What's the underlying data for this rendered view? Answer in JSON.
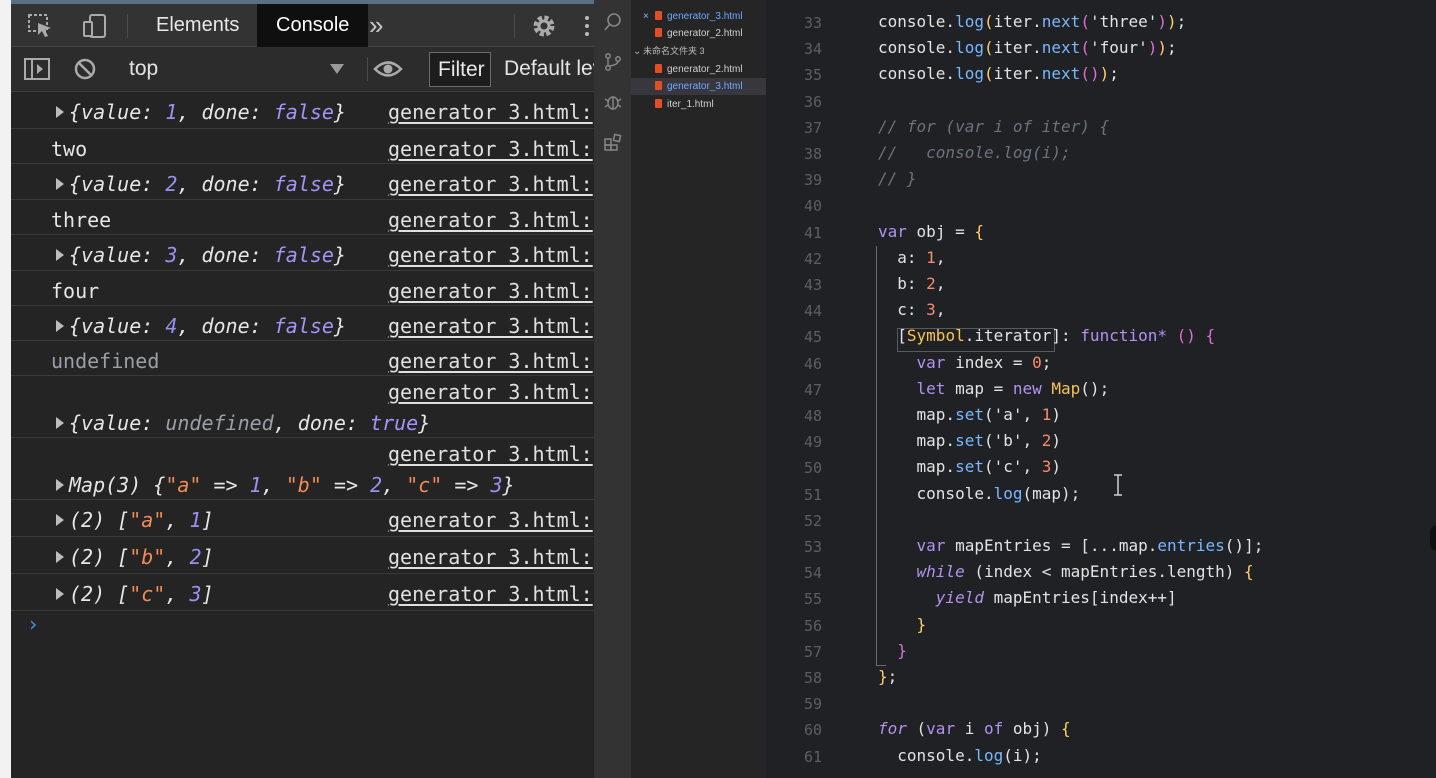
{
  "devtools": {
    "tabs": {
      "elements": "Elements",
      "console": "Console"
    },
    "toolbar": {
      "context": "top",
      "filter": "Filter",
      "levels": "Default lev"
    },
    "log": [
      {
        "msg": [
          [
            "obj",
            "{value: "
          ],
          [
            "num",
            "1"
          ],
          [
            "obj",
            ", done: "
          ],
          [
            "kw",
            "false"
          ],
          [
            "obj",
            "}"
          ]
        ],
        "expandable": true,
        "src": "generator_3.html:"
      },
      {
        "msg": [
          [
            "plain",
            "two"
          ]
        ],
        "expandable": false,
        "src": "generator_3.html:"
      },
      {
        "msg": [
          [
            "obj",
            "{value: "
          ],
          [
            "num",
            "2"
          ],
          [
            "obj",
            ", done: "
          ],
          [
            "kw",
            "false"
          ],
          [
            "obj",
            "}"
          ]
        ],
        "expandable": true,
        "src": "generator_3.html:"
      },
      {
        "msg": [
          [
            "plain",
            "three"
          ]
        ],
        "expandable": false,
        "src": "generator_3.html:"
      },
      {
        "msg": [
          [
            "obj",
            "{value: "
          ],
          [
            "num",
            "3"
          ],
          [
            "obj",
            ", done: "
          ],
          [
            "kw",
            "false"
          ],
          [
            "obj",
            "}"
          ]
        ],
        "expandable": true,
        "src": "generator_3.html:"
      },
      {
        "msg": [
          [
            "plain",
            "four"
          ]
        ],
        "expandable": false,
        "src": "generator_3.html:"
      },
      {
        "msg": [
          [
            "obj",
            "{value: "
          ],
          [
            "num",
            "4"
          ],
          [
            "obj",
            ", done: "
          ],
          [
            "kw",
            "false"
          ],
          [
            "obj",
            "}"
          ]
        ],
        "expandable": true,
        "src": "generator_3.html:"
      },
      {
        "msg": [
          [
            "und",
            "undefined"
          ]
        ],
        "expandable": false,
        "src": "generator_3.html:"
      },
      {
        "msg": [
          [
            "obj",
            "{value: "
          ],
          [
            "und",
            "undefined"
          ],
          [
            "obj",
            ", done: "
          ],
          [
            "kw",
            "true"
          ],
          [
            "obj",
            "}"
          ]
        ],
        "expandable": true,
        "src": "generator_3.html:",
        "wrap": true
      },
      {
        "msg": [
          [
            "obj",
            "Map(3) {"
          ],
          [
            "str",
            "\"a\""
          ],
          [
            "obj",
            " => "
          ],
          [
            "num",
            "1"
          ],
          [
            "obj",
            ", "
          ],
          [
            "str",
            "\"b\""
          ],
          [
            "obj",
            " => "
          ],
          [
            "num",
            "2"
          ],
          [
            "obj",
            ", "
          ],
          [
            "str",
            "\"c\""
          ],
          [
            "obj",
            " => "
          ],
          [
            "num",
            "3"
          ],
          [
            "obj",
            "}"
          ]
        ],
        "expandable": true,
        "src": "generator_3.html:",
        "wrap": true
      },
      {
        "msg": [
          [
            "obj",
            "(2) ["
          ],
          [
            "str",
            "\"a\""
          ],
          [
            "obj",
            ", "
          ],
          [
            "num",
            "1"
          ],
          [
            "obj",
            "]"
          ]
        ],
        "expandable": true,
        "src": "generator_3.html:"
      },
      {
        "msg": [
          [
            "obj",
            "(2) ["
          ],
          [
            "str",
            "\"b\""
          ],
          [
            "obj",
            ", "
          ],
          [
            "num",
            "2"
          ],
          [
            "obj",
            "]"
          ]
        ],
        "expandable": true,
        "src": "generator_3.html:"
      },
      {
        "msg": [
          [
            "obj",
            "(2) ["
          ],
          [
            "str",
            "\"c\""
          ],
          [
            "obj",
            ", "
          ],
          [
            "num",
            "3"
          ],
          [
            "obj",
            "]"
          ]
        ],
        "expandable": true,
        "src": "generator_3.html:"
      }
    ],
    "prompt_symbol": "›"
  },
  "vscode": {
    "explorer": {
      "open_editors": [
        {
          "name": "generator_3.html",
          "active": true,
          "closable": true
        },
        {
          "name": "generator_2.html",
          "active": false
        }
      ],
      "folder_label": "未命名文件夹 3",
      "files": [
        {
          "name": "generator_2.html",
          "active": false
        },
        {
          "name": "generator_3.html",
          "active": true
        },
        {
          "name": "iter_1.html",
          "active": false
        }
      ]
    },
    "code": [
      {
        "ln": "33",
        "tokens": [
          [
            "c-id",
            "console."
          ],
          [
            "c-fn",
            "log"
          ],
          [
            "c-br",
            "("
          ],
          [
            "c-id",
            "iter."
          ],
          [
            "c-fn",
            "next"
          ],
          [
            "c-br2",
            "("
          ],
          [
            "c-str",
            "'three'"
          ],
          [
            "c-br2",
            ")"
          ],
          [
            "c-br",
            ")"
          ],
          [
            "c-id",
            ";"
          ]
        ]
      },
      {
        "ln": "34",
        "tokens": [
          [
            "c-id",
            "console."
          ],
          [
            "c-fn",
            "log"
          ],
          [
            "c-br",
            "("
          ],
          [
            "c-id",
            "iter."
          ],
          [
            "c-fn",
            "next"
          ],
          [
            "c-br2",
            "("
          ],
          [
            "c-str",
            "'four'"
          ],
          [
            "c-br2",
            ")"
          ],
          [
            "c-br",
            ")"
          ],
          [
            "c-id",
            ";"
          ]
        ]
      },
      {
        "ln": "35",
        "tokens": [
          [
            "c-id",
            "console."
          ],
          [
            "c-fn",
            "log"
          ],
          [
            "c-br",
            "("
          ],
          [
            "c-id",
            "iter."
          ],
          [
            "c-fn",
            "next"
          ],
          [
            "c-br2",
            "()"
          ],
          [
            "c-br",
            ")"
          ],
          [
            "c-id",
            ";"
          ]
        ]
      },
      {
        "ln": "36",
        "tokens": []
      },
      {
        "ln": "37",
        "tokens": [
          [
            "c-cmt",
            "// for (var i of iter) {"
          ]
        ]
      },
      {
        "ln": "38",
        "tokens": [
          [
            "c-cmt",
            "//   console.log(i);"
          ]
        ]
      },
      {
        "ln": "39",
        "tokens": [
          [
            "c-cmt",
            "// }"
          ]
        ]
      },
      {
        "ln": "40",
        "tokens": []
      },
      {
        "ln": "41",
        "tokens": [
          [
            "c-kw",
            "var "
          ],
          [
            "c-id",
            "obj = "
          ],
          [
            "c-br",
            "{"
          ]
        ]
      },
      {
        "ln": "42",
        "tokens": [
          [
            "c-id",
            "  a: "
          ],
          [
            "c-num",
            "1"
          ],
          [
            "c-id",
            ","
          ]
        ]
      },
      {
        "ln": "43",
        "tokens": [
          [
            "c-id",
            "  b: "
          ],
          [
            "c-num",
            "2"
          ],
          [
            "c-id",
            ","
          ]
        ]
      },
      {
        "ln": "44",
        "tokens": [
          [
            "c-id",
            "  c: "
          ],
          [
            "c-num",
            "3"
          ],
          [
            "c-id",
            ","
          ]
        ]
      },
      {
        "ln": "45",
        "tokens": [
          [
            "c-id",
            "  ["
          ],
          [
            "c-sym",
            "Symbol"
          ],
          [
            "c-id",
            ".iterator]: "
          ],
          [
            "c-kw",
            "function* "
          ],
          [
            "c-br2",
            "() {"
          ]
        ]
      },
      {
        "ln": "46",
        "tokens": [
          [
            "c-kw",
            "    var "
          ],
          [
            "c-id",
            "index = "
          ],
          [
            "c-num",
            "0"
          ],
          [
            "c-id",
            ";"
          ]
        ]
      },
      {
        "ln": "47",
        "tokens": [
          [
            "c-kw",
            "    let "
          ],
          [
            "c-id",
            "map = "
          ],
          [
            "c-kw",
            "new "
          ],
          [
            "c-sym",
            "Map"
          ],
          [
            "c-id",
            "();"
          ]
        ]
      },
      {
        "ln": "48",
        "tokens": [
          [
            "c-id",
            "    map."
          ],
          [
            "c-fn",
            "set"
          ],
          [
            "c-id",
            "('a', "
          ],
          [
            "c-num",
            "1"
          ],
          [
            "c-id",
            ")"
          ]
        ]
      },
      {
        "ln": "49",
        "tokens": [
          [
            "c-id",
            "    map."
          ],
          [
            "c-fn",
            "set"
          ],
          [
            "c-id",
            "('b', "
          ],
          [
            "c-num",
            "2"
          ],
          [
            "c-id",
            ")"
          ]
        ]
      },
      {
        "ln": "50",
        "tokens": [
          [
            "c-id",
            "    map."
          ],
          [
            "c-fn",
            "set"
          ],
          [
            "c-id",
            "('c', "
          ],
          [
            "c-num",
            "3"
          ],
          [
            "c-id",
            ")"
          ]
        ]
      },
      {
        "ln": "51",
        "tokens": [
          [
            "c-id",
            "    console."
          ],
          [
            "c-fn",
            "log"
          ],
          [
            "c-id",
            "(map);"
          ]
        ]
      },
      {
        "ln": "52",
        "tokens": []
      },
      {
        "ln": "53",
        "tokens": [
          [
            "c-kw",
            "    var "
          ],
          [
            "c-id",
            "mapEntries = [...map."
          ],
          [
            "c-fn",
            "entries"
          ],
          [
            "c-id",
            "()];"
          ]
        ]
      },
      {
        "ln": "54",
        "tokens": [
          [
            "c-kw c-yield",
            "    while "
          ],
          [
            "c-id",
            "(index < mapEntries.length) "
          ],
          [
            "c-br",
            "{"
          ]
        ]
      },
      {
        "ln": "55",
        "tokens": [
          [
            "c-kw c-yield",
            "      yield "
          ],
          [
            "c-id",
            "mapEntries[index++]"
          ]
        ]
      },
      {
        "ln": "56",
        "tokens": [
          [
            "c-br",
            "    }"
          ]
        ]
      },
      {
        "ln": "57",
        "tokens": [
          [
            "c-br2",
            "  }"
          ]
        ]
      },
      {
        "ln": "58",
        "tokens": [
          [
            "c-br",
            "}"
          ],
          [
            "c-id",
            ";"
          ]
        ]
      },
      {
        "ln": "59",
        "tokens": []
      },
      {
        "ln": "60",
        "tokens": [
          [
            "c-kw c-yield",
            "for "
          ],
          [
            "c-id",
            "("
          ],
          [
            "c-kw",
            "var "
          ],
          [
            "c-id",
            "i "
          ],
          [
            "c-kw",
            "of "
          ],
          [
            "c-id",
            "obj) "
          ],
          [
            "c-br",
            "{"
          ]
        ]
      },
      {
        "ln": "61",
        "tokens": [
          [
            "c-id",
            "  console."
          ],
          [
            "c-fn",
            "log"
          ],
          [
            "c-id",
            "(i);"
          ]
        ]
      }
    ]
  }
}
